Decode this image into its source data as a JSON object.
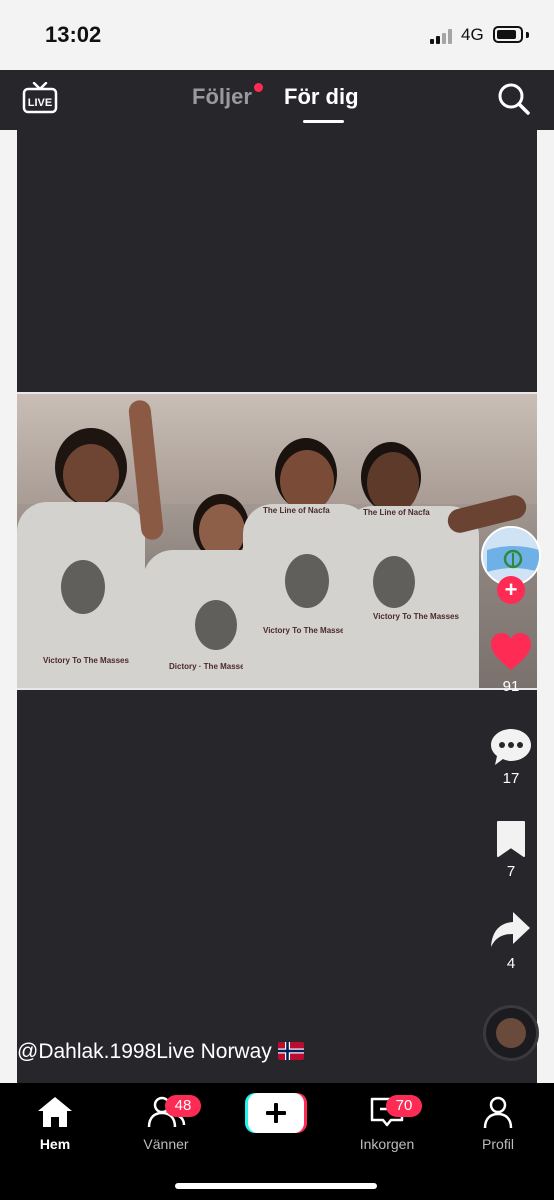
{
  "status_bar": {
    "time": "13:02",
    "network": "4G"
  },
  "top_nav": {
    "live_label": "LIVE",
    "tabs": [
      {
        "label": "Följer",
        "has_notification_dot": true
      },
      {
        "label": "För dig",
        "active": true
      }
    ],
    "icons": {
      "live": "live-tv-icon",
      "search": "search-icon"
    }
  },
  "video": {
    "shirt_texts": [
      "The Line of Nacfa",
      "Victory To The Masses"
    ]
  },
  "actions": {
    "likes": "91",
    "comments": "17",
    "bookmarks": "7",
    "shares": "4"
  },
  "caption": {
    "text": "@Dahlak.1998Live Norway"
  },
  "bottom_nav": {
    "items": [
      {
        "label": "Hem",
        "icon": "home-icon",
        "active": true
      },
      {
        "label": "Vänner",
        "icon": "friends-icon",
        "badge": "48"
      },
      {
        "label": "",
        "icon": "create-plus-icon"
      },
      {
        "label": "Inkorgen",
        "icon": "inbox-icon",
        "badge": "70"
      },
      {
        "label": "Profil",
        "icon": "profile-icon"
      }
    ]
  },
  "colors": {
    "accent": "#fe2c55",
    "background": "#27262b",
    "nav": "#000000"
  }
}
